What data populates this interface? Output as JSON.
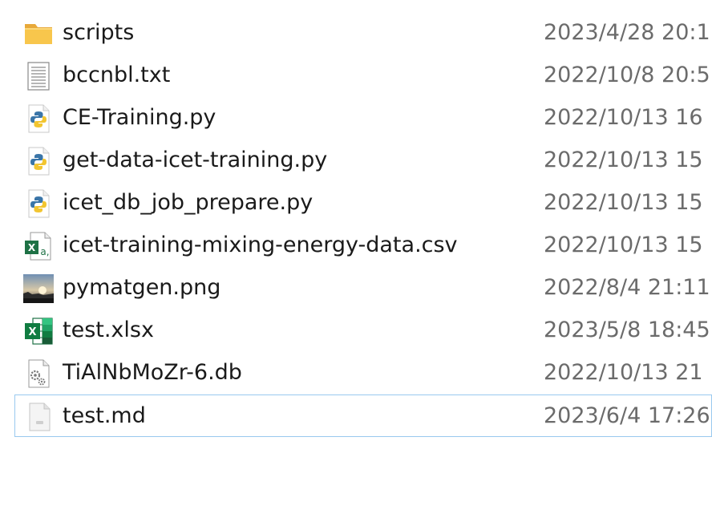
{
  "files": [
    {
      "name": "scripts",
      "date": "2023/4/28 20:1",
      "icon": "folder-icon"
    },
    {
      "name": "bccnbl.txt",
      "date": "2022/10/8 20:5",
      "icon": "text-file-icon"
    },
    {
      "name": "CE-Training.py",
      "date": "2022/10/13 16",
      "icon": "python-file-icon"
    },
    {
      "name": "get-data-icet-training.py",
      "date": "2022/10/13 15",
      "icon": "python-file-icon"
    },
    {
      "name": "icet_db_job_prepare.py",
      "date": "2022/10/13 15",
      "icon": "python-file-icon"
    },
    {
      "name": "icet-training-mixing-energy-data.csv",
      "date": "2022/10/13 15",
      "icon": "csv-file-icon"
    },
    {
      "name": "pymatgen.png",
      "date": "2022/8/4 21:11",
      "icon": "image-thumbnail-icon"
    },
    {
      "name": "test.xlsx",
      "date": "2023/5/8 18:45",
      "icon": "excel-file-icon"
    },
    {
      "name": "TiAlNbMoZr-6.db",
      "date": "2022/10/13 21",
      "icon": "system-file-icon"
    },
    {
      "name": "test.md",
      "date": "2023/6/4 17:26",
      "icon": "generic-file-icon"
    }
  ],
  "colors": {
    "selection_border": "#99c9ef",
    "name_text": "#1a1a1a",
    "date_text": "#6b6b6b",
    "folder": "#f8c64c",
    "excel_green": "#1e7145"
  },
  "selected_index": 9
}
